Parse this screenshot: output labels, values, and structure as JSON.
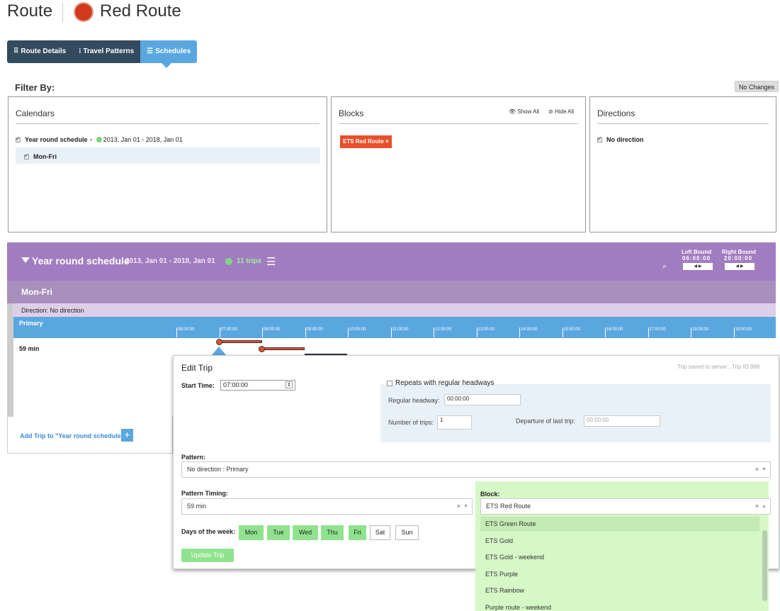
{
  "header": {
    "title": "Route",
    "route_name": "Red Route",
    "route_color": "#d13a1c"
  },
  "tabs": [
    {
      "label": "Route Details",
      "icon": "drag-icon"
    },
    {
      "label": "Travel Patterns",
      "icon": "branch-icon"
    },
    {
      "label": "Schedules",
      "icon": "filter-icon"
    }
  ],
  "filter": {
    "label": "Filter By:",
    "status_badge": "No Changes"
  },
  "calendars": {
    "title": "Calendars",
    "schedule_name": "Year round schedule",
    "schedule_dates": "2013, Jan 01 - 2018, Jan 01",
    "sub_item": "Mon-Fri"
  },
  "blocks": {
    "title": "Blocks",
    "show_all": "Show All",
    "hide_all": "Hide All",
    "chip": "ETS Red Route",
    "chip_close": "×"
  },
  "directions": {
    "title": "Directions",
    "item": "No direction"
  },
  "schedule": {
    "title": "Year round schedule",
    "dates": "2013, Jan 01 - 2018, Jan 01",
    "trips": "11 trips",
    "left_bound_label": "Left Bound",
    "left_bound_value": "06:00:00",
    "right_bound_label": "Right Bound",
    "right_bound_value": "20:00:00",
    "calendar": "Mon-Fri",
    "direction": "Direction: No direction",
    "pattern": "Primary",
    "duration": "59 min",
    "ticks": [
      "06:00:00",
      "07:00:00",
      "08:00:00",
      "09:00:00",
      "10:00:00",
      "11:00:00",
      "12:00:00",
      "13:00:00",
      "14:00:00",
      "15:00:00",
      "16:00:00",
      "17:00:00",
      "18:00:00",
      "19:00:00"
    ],
    "add_trip": "Add Trip to \"Year round schedule\"",
    "add_btn": "+"
  },
  "edit_trip": {
    "title": "Edit Trip",
    "saved": "Trip saved to server , Trip ID:988",
    "start_time_label": "Start Time:",
    "start_time": "07:00:00",
    "repeats_label": "Repeats with regular headways",
    "headway_label": "Regular headway:",
    "headway_value": "00:00:00",
    "num_trips_label": "Number of trips:",
    "num_trips_value": "1",
    "last_dep_label": "Departure of last trip:",
    "last_dep_placeholder": "00:00:00",
    "pattern_label": "Pattern:",
    "pattern_value": "No direction : Primary",
    "timing_label": "Pattern Timing:",
    "timing_value": "59 min",
    "block_label": "Block:",
    "block_value": "ETS Red Route",
    "block_options": [
      "ETS Green Route",
      "ETS Gold",
      "ETS Gold - weekend",
      "ETS Purple",
      "ETS Rainbow",
      "Purple route - weekend"
    ],
    "days_label": "Days of the week:",
    "days": [
      {
        "label": "Mon",
        "on": true
      },
      {
        "label": "Tue",
        "on": true
      },
      {
        "label": "Wed",
        "on": true
      },
      {
        "label": "Thu",
        "on": true
      },
      {
        "label": "Fri",
        "on": true
      },
      {
        "label": "Sat",
        "on": false
      },
      {
        "label": "Sun",
        "on": false
      }
    ],
    "update_btn": "Update Trip"
  }
}
